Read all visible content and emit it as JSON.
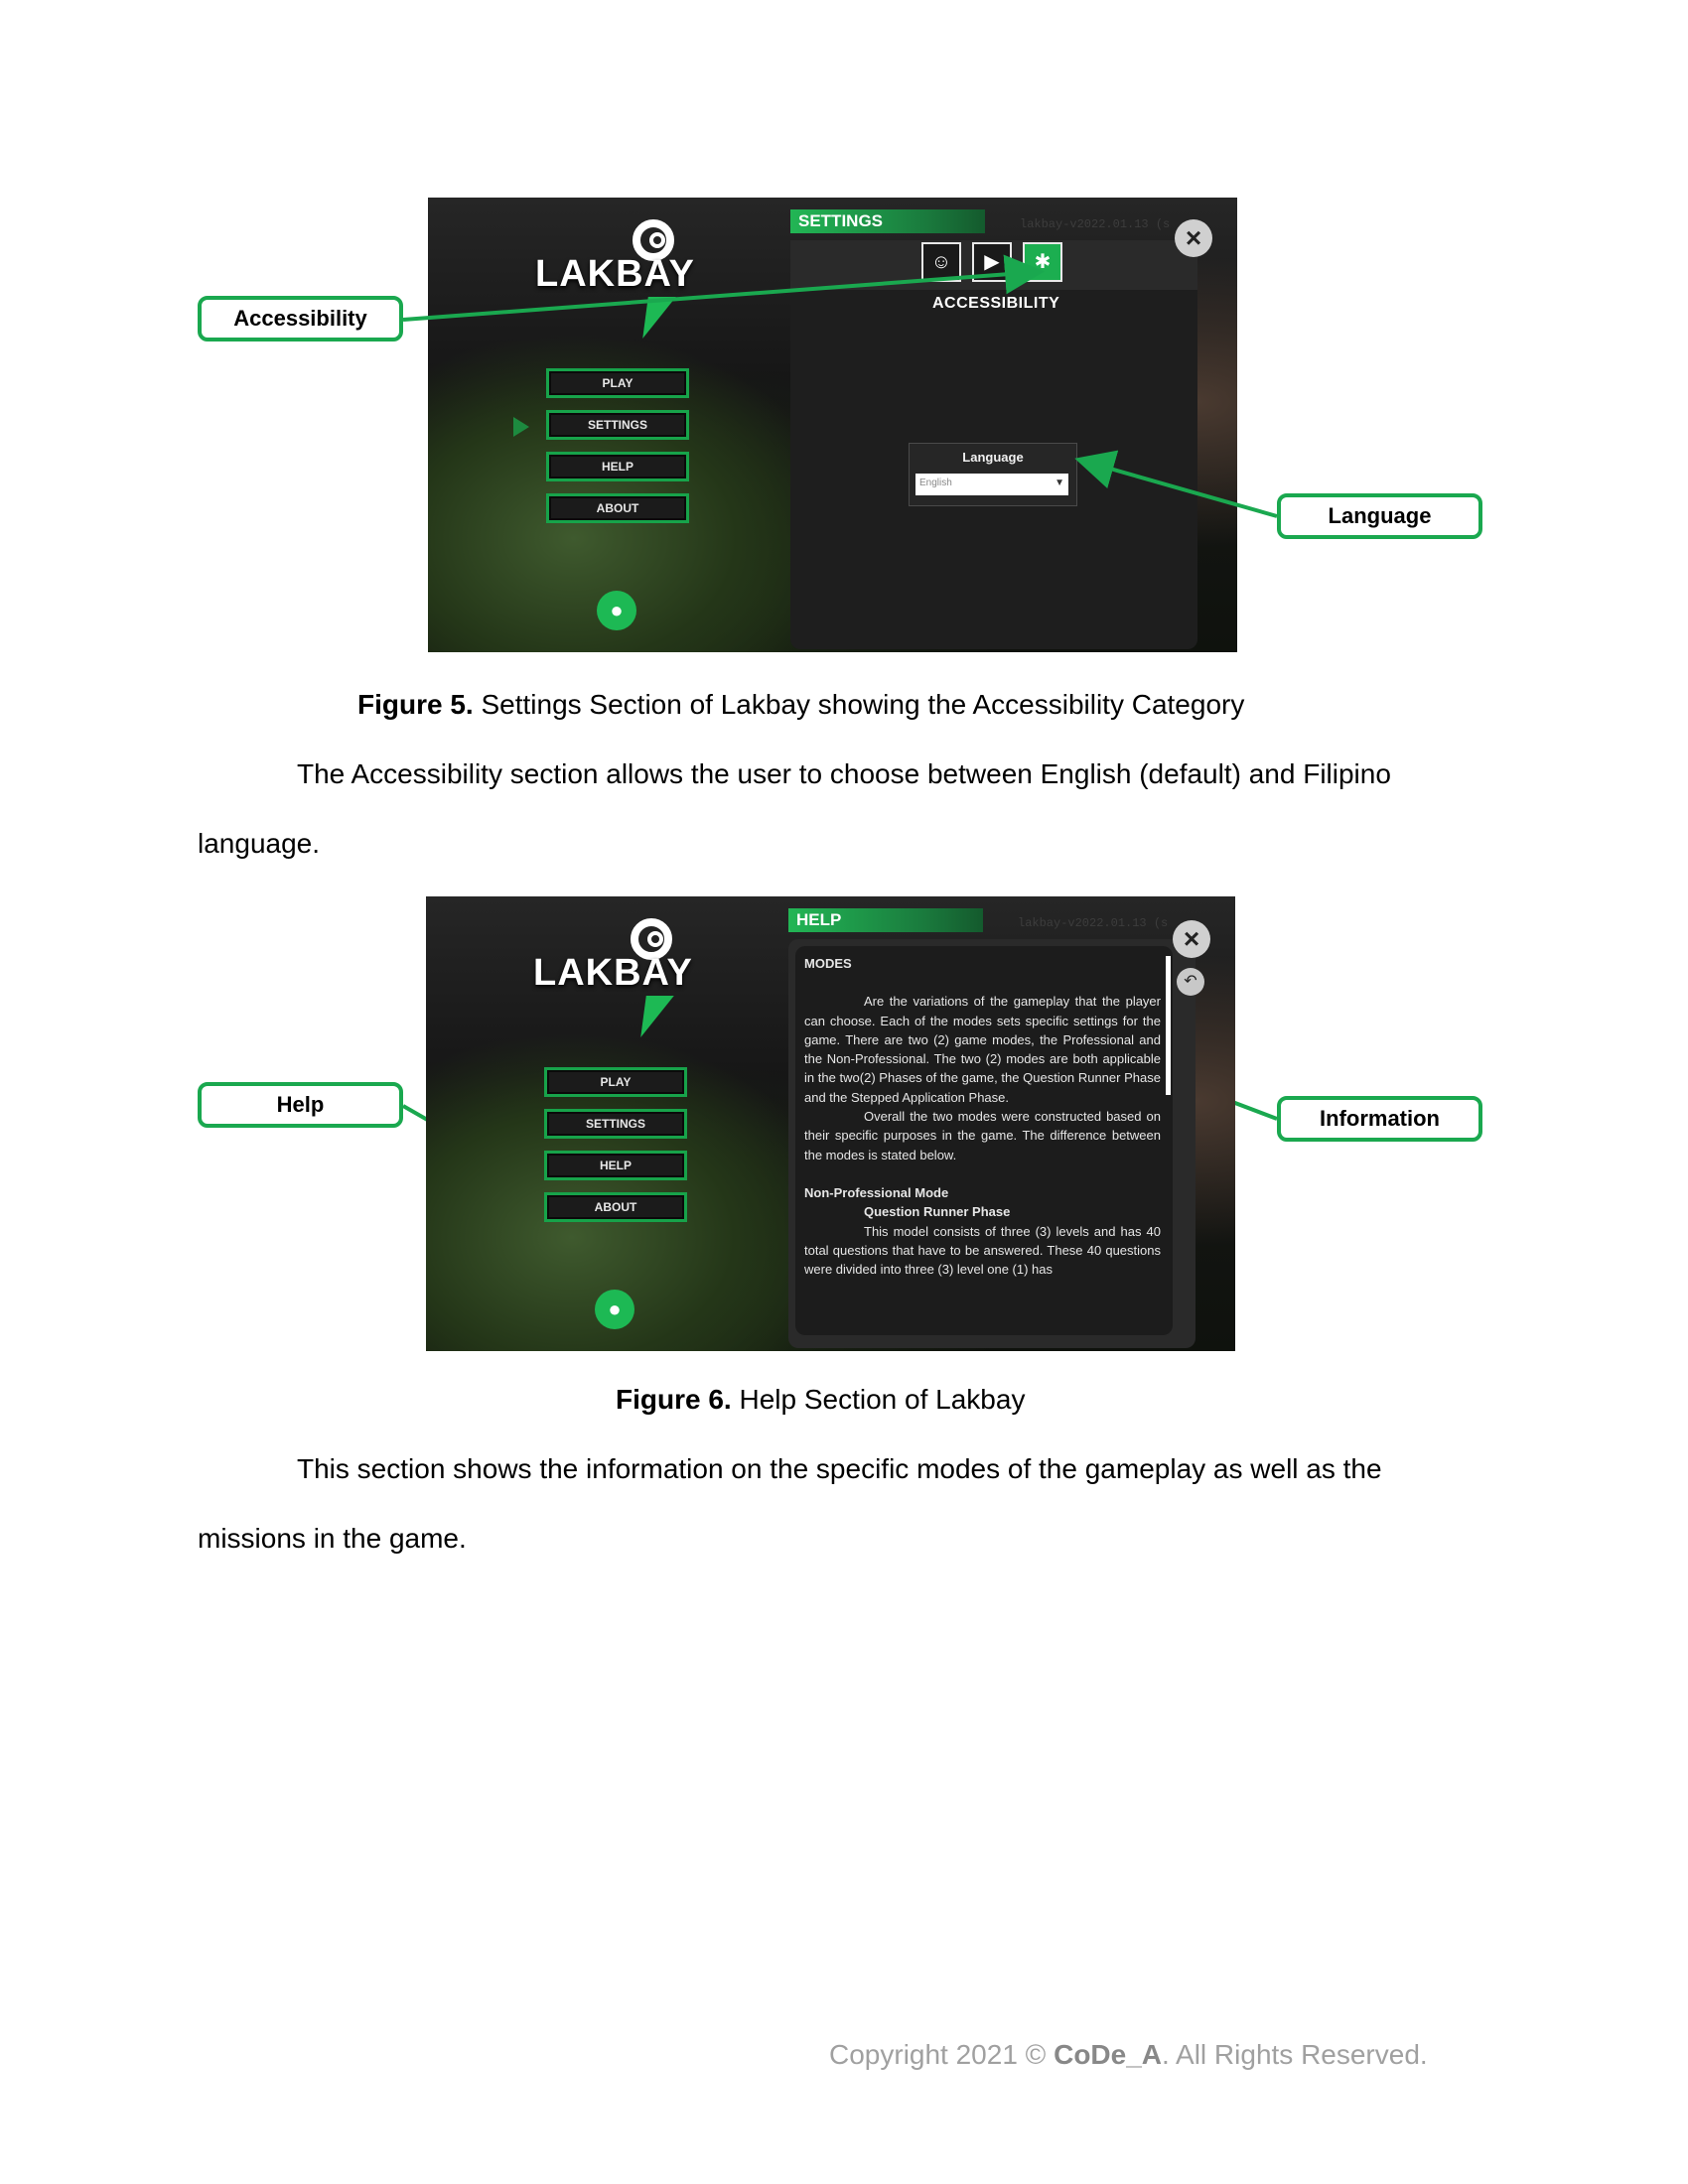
{
  "figure5": {
    "game": {
      "logo": "LAKBAY",
      "menu": [
        "PLAY",
        "SETTINGS",
        "HELP",
        "ABOUT"
      ],
      "panel_tab": "SETTINGS",
      "version": "lakbay-v2022.01.13 (s",
      "category_icons": [
        "headphones-icon",
        "video-camera-icon",
        "accessibility-icon"
      ],
      "section_title": "ACCESSIBILITY",
      "language_label": "Language",
      "language_value": "English"
    },
    "callouts": {
      "accessibility": "Accessibility",
      "language": "Language"
    },
    "caption_bold": "Figure 5.",
    "caption_text": " Settings Section of Lakbay showing the Accessibility Category"
  },
  "paragraph1": {
    "line1": "The Accessibility section allows the user to choose between English (default) and Filipino",
    "line2": "language."
  },
  "figure6": {
    "game": {
      "logo": "LAKBAY",
      "menu": [
        "PLAY",
        "SETTINGS",
        "HELP",
        "ABOUT"
      ],
      "panel_tab": "HELP",
      "version": "lakbay-v2022.01.13 (s",
      "modes_title": "MODES",
      "p1": "Are the variations of the gameplay that the player can choose. Each of the modes sets specific settings for the game. There are two (2) game modes, the Professional and the Non-Professional. The two (2) modes are both applicable in the two(2) Phases of the game, the Question Runner Phase and the Stepped Application Phase.",
      "p2": "Overall the two modes were constructed based on their specific purposes in the game. The difference between the modes is stated below.",
      "non_pro_heading": "Non-Professional Mode",
      "qr_heading": "Question Runner Phase",
      "p3": "This model consists of three (3) levels and has 40 total questions that have to be answered. These 40 questions were divided into three (3) level one (1) has"
    },
    "callouts": {
      "help": "Help",
      "information": "Information"
    },
    "caption_bold": "Figure 6.",
    "caption_text": " Help Section of Lakbay"
  },
  "paragraph2": {
    "line1": "This section shows the information on the specific modes of the gameplay as well as the",
    "line2": "missions in the game."
  },
  "footer": {
    "prefix": "Copyright 2021 © ",
    "brand": "CoDe_A",
    "suffix": ". All Rights Reserved."
  }
}
